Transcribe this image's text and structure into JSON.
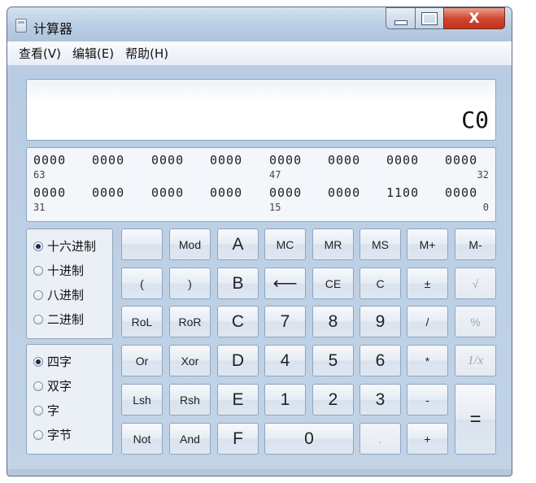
{
  "window": {
    "title": "计算器",
    "close_glyph": "X"
  },
  "menu": {
    "items": [
      "查看(V)",
      "编辑(E)",
      "帮助(H)"
    ]
  },
  "display": {
    "value": "C0"
  },
  "bits": {
    "row1": [
      "0000",
      "0000",
      "0000",
      "0000",
      "0000",
      "0000",
      "0000",
      "0000"
    ],
    "row1_labels": {
      "left": "63",
      "mid": "47",
      "right": "32"
    },
    "row2": [
      "0000",
      "0000",
      "0000",
      "0000",
      "0000",
      "0000",
      "1100",
      "0000"
    ],
    "row2_labels": {
      "left": "31",
      "mid": "15",
      "right": "0"
    }
  },
  "radix": {
    "options": [
      "十六进制",
      "十进制",
      "八进制",
      "二进制"
    ],
    "selected": 0
  },
  "word": {
    "options": [
      "四字",
      "双字",
      "字",
      "字节"
    ],
    "selected": 0
  },
  "buttons": {
    "blank": "",
    "mod": "Mod",
    "a": "A",
    "mc": "MC",
    "mr": "MR",
    "ms": "MS",
    "mplus": "M+",
    "mminus": "M-",
    "lparen": "(",
    "rparen": ")",
    "b": "B",
    "back": "⟵",
    "ce": "CE",
    "c": "C",
    "plusminus": "±",
    "sqrt": "√",
    "rol": "RoL",
    "ror": "RoR",
    "hc": "C",
    "n7": "7",
    "n8": "8",
    "n9": "9",
    "div": "/",
    "pct": "%",
    "or": "Or",
    "xor": "Xor",
    "d": "D",
    "n4": "4",
    "n5": "5",
    "n6": "6",
    "mul": "*",
    "recip": "1/x",
    "lsh": "Lsh",
    "rsh": "Rsh",
    "e": "E",
    "n1": "1",
    "n2": "2",
    "n3": "3",
    "sub": "-",
    "eq": "=",
    "not": "Not",
    "and": "And",
    "f": "F",
    "n0": "0",
    "dot": ".",
    "add": "+"
  }
}
